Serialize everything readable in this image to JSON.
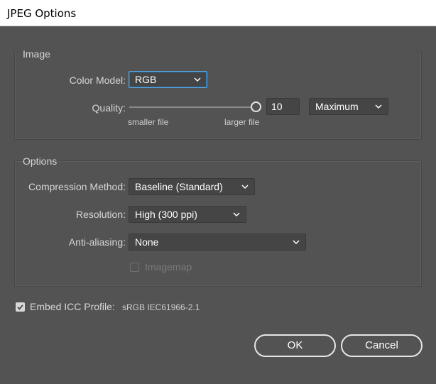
{
  "window": {
    "title": "JPEG Options"
  },
  "image_group": {
    "label": "Image",
    "color_model_label": "Color Model:",
    "color_model_value": "RGB",
    "quality_label": "Quality:",
    "quality_value": "10",
    "quality_level": 1.0,
    "quality_preset": "Maximum",
    "smaller_file_label": "smaller file",
    "larger_file_label": "larger file"
  },
  "options_group": {
    "label": "Options",
    "compression_label": "Compression Method:",
    "compression_value": "Baseline (Standard)",
    "resolution_label": "Resolution:",
    "resolution_value": "High (300 ppi)",
    "antialiasing_label": "Anti-aliasing:",
    "antialiasing_value": "None",
    "imagemap_label": "Imagemap",
    "imagemap_checked": false
  },
  "icc": {
    "label": "Embed ICC Profile:",
    "profile": "sRGB IEC61966-2.1",
    "checked": true
  },
  "buttons": {
    "ok": "OK",
    "cancel": "Cancel"
  },
  "icons": {
    "chevron": "chevron-down-icon",
    "check": "checkmark-icon",
    "slider_thumb": "slider-thumb"
  },
  "colors": {
    "background": "#535353",
    "field": "#454545",
    "text": "#d6d6d6",
    "focus": "#5aa7e0"
  }
}
